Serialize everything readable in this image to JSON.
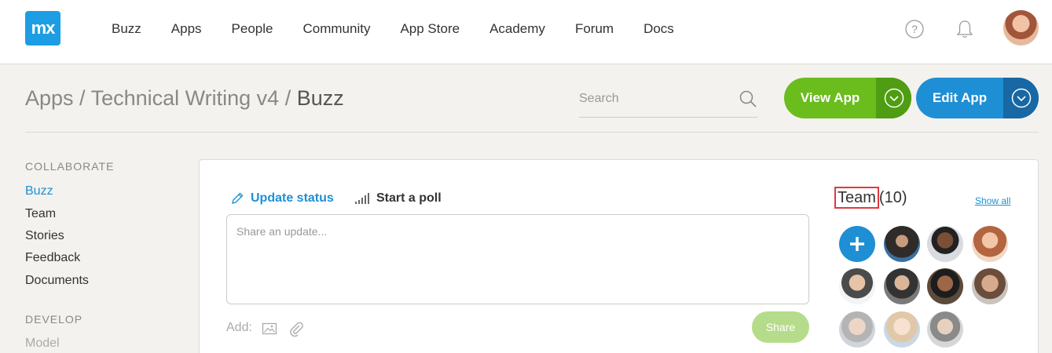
{
  "topbar": {
    "logo_text": "mx",
    "nav": [
      "Buzz",
      "Apps",
      "People",
      "Community",
      "App Store",
      "Academy",
      "Forum",
      "Docs"
    ],
    "icons": [
      "help-icon",
      "bell-icon",
      "user-avatar"
    ]
  },
  "header": {
    "breadcrumb": {
      "root": "Apps",
      "sep1": " / ",
      "app": "Technical Writing v4",
      "sep2": " / ",
      "current": "Buzz"
    },
    "search_placeholder": "Search",
    "view_app_label": "View App",
    "edit_app_label": "Edit App",
    "colors": {
      "view": "#6bbd1e",
      "edit": "#1e8fd4"
    }
  },
  "sidebar": {
    "collaborate_title": "COLLABORATE",
    "collaborate_items": [
      {
        "label": "Buzz",
        "active": true
      },
      {
        "label": "Team"
      },
      {
        "label": "Stories"
      },
      {
        "label": "Feedback"
      },
      {
        "label": "Documents"
      }
    ],
    "develop_title": "DEVELOP",
    "develop_items": [
      {
        "label": "Model"
      }
    ]
  },
  "composer": {
    "tab_update": "Update status",
    "tab_poll": "Start a poll",
    "placeholder": "Share an update...",
    "add_label": "Add:",
    "share_label": "Share"
  },
  "team": {
    "title": "Team",
    "count": "(10)",
    "show_all": "Show all",
    "member_icons": [
      "member-avatar",
      "member-avatar",
      "member-avatar",
      "member-avatar",
      "member-avatar",
      "member-avatar",
      "member-avatar",
      "member-avatar",
      "member-avatar",
      "member-avatar"
    ]
  }
}
